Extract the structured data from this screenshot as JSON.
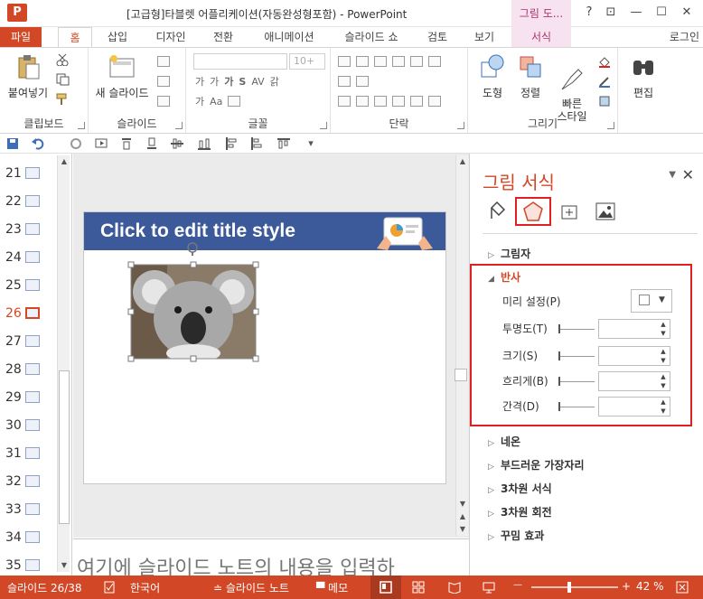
{
  "window": {
    "app_icon": "P",
    "title": "[고급형]타블렛 어플리케이션(자동완성형포함) - PowerPoint",
    "contextual_title": "그림 도...",
    "help": "?",
    "restore_ribbon": "⊡",
    "minimize": "—",
    "maximize": "☐",
    "close": "✕"
  },
  "tabs": {
    "file": "파일",
    "items": [
      "홈",
      "삽입",
      "디자인",
      "전환",
      "애니메이션",
      "슬라이드 쇼",
      "검토",
      "보기",
      "서식"
    ],
    "active": "홈",
    "login": "로그인"
  },
  "ribbon": {
    "clipboard": {
      "paste": "붙여넣기",
      "label": "클립보드"
    },
    "slides": {
      "new_slide": "새 슬라이드",
      "label": "슬라이드"
    },
    "font": {
      "size": "10+",
      "label": "글꼴",
      "bold": "가",
      "shadow": "S",
      "spacing": "AV",
      "case": "Aa",
      "hangul": "갉",
      "size_grow": "가",
      "size_shrink": "가"
    },
    "paragraph": {
      "label": "단락"
    },
    "drawing": {
      "shapes": "도형",
      "arrange": "정렬",
      "quick_styles": "빠른\n스타일",
      "label": "그리기"
    },
    "editing": {
      "edit": "편집"
    }
  },
  "thumbnails": {
    "numbers": [
      "21",
      "22",
      "23",
      "24",
      "25",
      "26",
      "27",
      "28",
      "29",
      "30",
      "31",
      "32",
      "33",
      "34",
      "35"
    ],
    "current": "26"
  },
  "slide": {
    "title": "Click to edit title style"
  },
  "notes": {
    "placeholder": "여기에 슬라이드 노트의 내용을 입력하"
  },
  "format_pane": {
    "title": "그림 서식",
    "sections": {
      "shadow": "그림자",
      "reflection": "반사",
      "glow": "네온",
      "soft_edges": "부드러운 가장자리",
      "format3d": "3차원 서식",
      "rotation3d": "3차원 회전",
      "artistic": "꾸밈 효과"
    },
    "reflection_props": {
      "presets": "미리 설정(P)",
      "transparency": "투명도(T)",
      "size": "크기(S)",
      "blur": "흐리게(B)",
      "distance": "간격(D)"
    }
  },
  "status": {
    "slide": "슬라이드 26/38",
    "language": "한국어",
    "notes": "슬라이드 노트",
    "comments": "메모",
    "zoom": "42 %",
    "minus": "—",
    "plus": "+"
  },
  "colors": {
    "accent": "#d24726",
    "slide_header": "#3c5a99",
    "highlight_box": "#e02020"
  }
}
